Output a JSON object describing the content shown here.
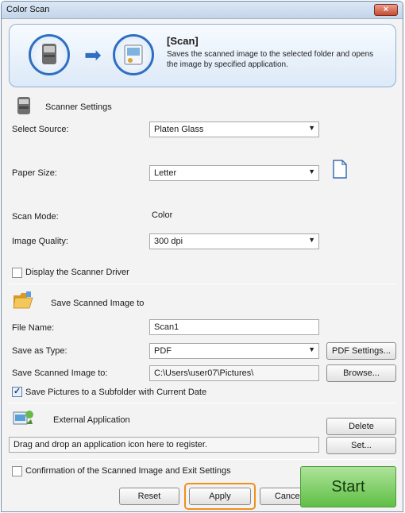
{
  "window": {
    "title": "Color Scan",
    "close_label": "×"
  },
  "banner": {
    "title": "[Scan]",
    "description": "Saves the scanned image to the selected folder and opens the image by specified application.",
    "icons": [
      "scanner-icon",
      "arrow-right-icon",
      "application-icon"
    ]
  },
  "scanner_settings": {
    "heading": "Scanner Settings",
    "select_source": {
      "label": "Select Source:",
      "value": "Platen Glass"
    },
    "paper_size": {
      "label": "Paper Size:",
      "value": "Letter"
    },
    "scan_mode": {
      "label": "Scan Mode:",
      "value": "Color"
    },
    "image_quality": {
      "label": "Image Quality:",
      "value": "300 dpi"
    },
    "display_driver": {
      "label": "Display the Scanner Driver",
      "checked": false
    }
  },
  "save_settings": {
    "heading": "Save Scanned Image to",
    "file_name": {
      "label": "File Name:",
      "value": "Scan1"
    },
    "save_as_type": {
      "label": "Save as Type:",
      "value": "PDF"
    },
    "pdf_settings_label": "PDF Settings...",
    "save_to": {
      "label": "Save Scanned Image to:",
      "value": "C:\\Users\\user07\\Pictures\\"
    },
    "browse_label": "Browse...",
    "subfolder": {
      "label": "Save Pictures to a Subfolder with Current Date",
      "checked": true
    }
  },
  "external_app": {
    "heading": "External Application",
    "hint": "Drag and drop an application icon here to register.",
    "delete_label": "Delete",
    "set_label": "Set..."
  },
  "footer": {
    "confirmation": {
      "label": "Confirmation of the Scanned Image and Exit Settings",
      "checked": false
    },
    "reset_label": "Reset",
    "apply_label": "Apply",
    "cancel_label": "Cancel",
    "start_label": "Start"
  },
  "colors": {
    "accent": "#2f6fc2",
    "start_green": "#5fbf45",
    "highlight": "#f0901e"
  }
}
